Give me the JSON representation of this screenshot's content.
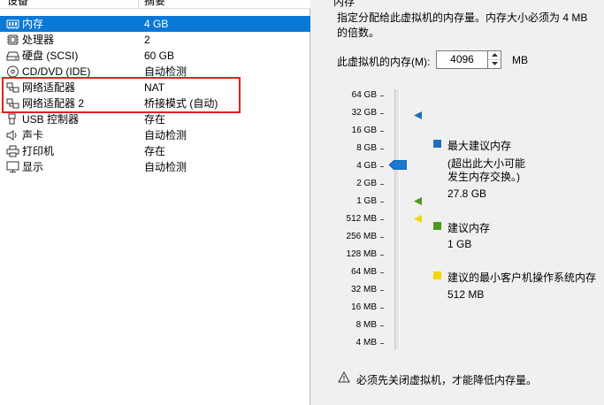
{
  "device_list": {
    "headers": {
      "device": "设备",
      "summary": "摘要"
    },
    "devices": [
      {
        "name": "内存",
        "summary": "4 GB",
        "icon": "memory-icon",
        "selected": true
      },
      {
        "name": "处理器",
        "summary": "2",
        "icon": "processor-icon",
        "selected": false
      },
      {
        "name": "硬盘 (SCSI)",
        "summary": "60 GB",
        "icon": "hard-disk-icon",
        "selected": false
      },
      {
        "name": "CD/DVD (IDE)",
        "summary": "自动检测",
        "icon": "cd-dvd-icon",
        "selected": false
      },
      {
        "name": "网络适配器",
        "summary": "NAT",
        "icon": "network-adapter-icon",
        "selected": false
      },
      {
        "name": "网络适配器 2",
        "summary": "桥接模式 (自动)",
        "icon": "network-adapter-icon",
        "selected": false
      },
      {
        "name": "USB 控制器",
        "summary": "存在",
        "icon": "usb-controller-icon",
        "selected": false
      },
      {
        "name": "声卡",
        "summary": "自动检测",
        "icon": "sound-card-icon",
        "selected": false
      },
      {
        "name": "打印机",
        "summary": "存在",
        "icon": "printer-icon",
        "selected": false
      },
      {
        "name": "显示",
        "summary": "自动检测",
        "icon": "display-icon",
        "selected": false
      }
    ],
    "highlight_color": "#e02020",
    "selection_color": "#0a78d7"
  },
  "memory_panel": {
    "title": "内存",
    "description": "指定分配给此虚拟机的内存量。内存大小必须为 4 MB 的倍数。",
    "memory_label": "此虚拟机的内存(M):",
    "memory_value": "4096",
    "memory_unit": "MB",
    "scale_labels": [
      "64 GB",
      "32 GB",
      "16 GB",
      "8 GB",
      "4 GB",
      "2 GB",
      "1 GB",
      "512 MB",
      "256 MB",
      "128 MB",
      "64 MB",
      "32 MB",
      "16 MB",
      "8 MB",
      "4 MB"
    ],
    "legend": {
      "max_recommended": {
        "title": "最大建议内存",
        "note_line1": "(超出此大小可能",
        "note_line2": "发生内存交换。)",
        "value": "27.8 GB",
        "color": "#1f6fb5"
      },
      "recommended": {
        "title": "建议内存",
        "value": "1 GB",
        "color": "#4a9a1e"
      },
      "min_recommended": {
        "title": "建议的最小客户机操作系统内存",
        "value": "512 MB",
        "color": "#f2d600"
      }
    },
    "warning": "必须先关闭虚拟机，才能降低内存量。",
    "warning_icon": "warning-icon"
  }
}
